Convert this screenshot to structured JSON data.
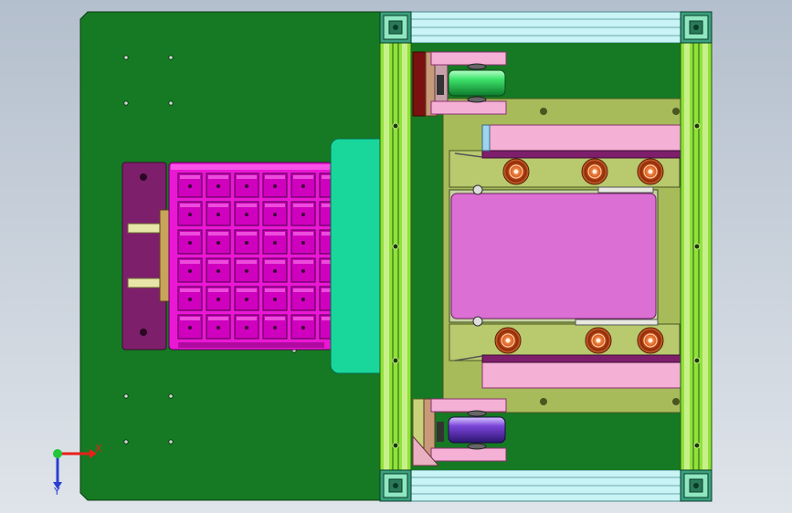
{
  "viewport": {
    "background_top": "#b4bfcd",
    "background_bottom": "#dfe4ea"
  },
  "colors": {
    "base_plate": "#157a23",
    "extrusion_green": "#8fe23a",
    "extrusion_light": "#c8f08a",
    "rail_cyan": "#c8f4f6",
    "tray_magenta": "#ea17d5",
    "block_purple": "#7e1f6c",
    "guide_teal": "#19d79b",
    "olive_plate": "#a8bb5a",
    "pink_part": "#f5b0d6",
    "carrier_violet": "#dc6fd4",
    "roller_orange": "#d85a1e",
    "wheel_green": "#3ee36a",
    "wheel_violet": "#7a45d8",
    "corner_teal": "#3aa17e"
  },
  "tray_grid": {
    "rows": 6,
    "cols": 6
  },
  "triad": {
    "x_label": "X",
    "y_label": "Y",
    "x_color": "#e8201a",
    "y_color": "#2a3fd0",
    "origin_color": "#22c63a"
  }
}
